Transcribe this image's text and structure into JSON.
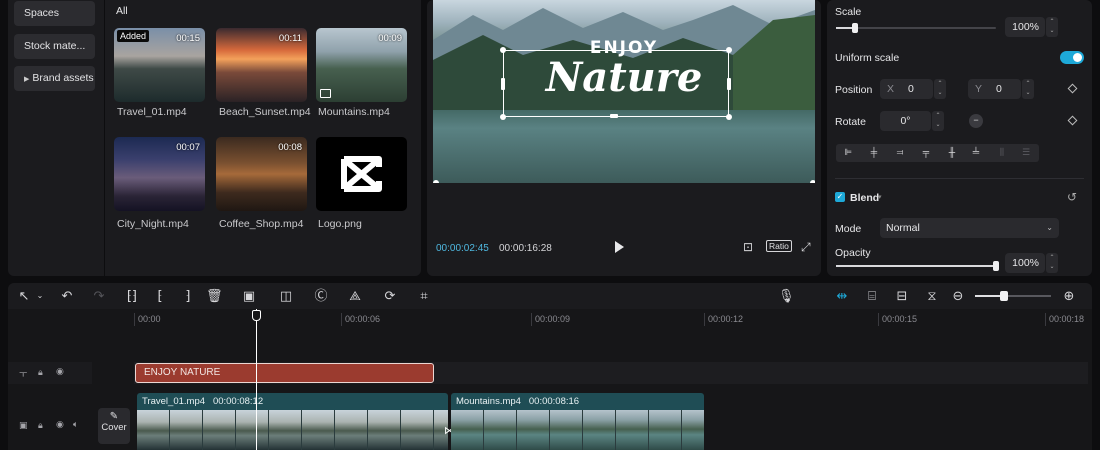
{
  "left_nav": {
    "items": [
      {
        "label": "Spaces",
        "has_arrow": false
      },
      {
        "label": "Stock mate...",
        "has_arrow": false
      },
      {
        "label": "Brand assets",
        "has_arrow": true
      }
    ]
  },
  "media": {
    "tab": "All",
    "items": [
      {
        "name": "Travel_01.mp4",
        "duration": "00:15",
        "badge": "Added"
      },
      {
        "name": "Beach_Sunset.mp4",
        "duration": "00:11",
        "badge": ""
      },
      {
        "name": "Mountains.mp4",
        "duration": "00:09",
        "badge": ""
      },
      {
        "name": "City_Night.mp4",
        "duration": "00:07",
        "badge": ""
      },
      {
        "name": "Coffee_Shop.mp4",
        "duration": "00:08",
        "badge": ""
      },
      {
        "name": "Logo.png",
        "duration": "",
        "badge": ""
      }
    ]
  },
  "player": {
    "overlay_line1": "ENJOY",
    "overlay_line2": "Nature",
    "current_time": "00:00:02:45",
    "total_time": "00:00:16:28",
    "ratio_label": "Ratio"
  },
  "inspector": {
    "scale_label": "Scale",
    "scale_value": "100%",
    "scale_fraction": 0.12,
    "uniform_scale_label": "Uniform scale",
    "uniform_scale_on": true,
    "position_label": "Position",
    "pos_x_label": "X",
    "pos_x_value": "0",
    "pos_y_label": "Y",
    "pos_y_value": "0",
    "rotate_label": "Rotate",
    "rotate_value": "0°",
    "blend_label": "Blend",
    "blend_checked": true,
    "mode_label": "Mode",
    "mode_value": "Normal",
    "opacity_label": "Opacity",
    "opacity_value": "100%",
    "opacity_fraction": 1.0
  },
  "timeline": {
    "ruler": [
      "00:00",
      "00:00:06",
      "00:00:09",
      "00:00:12",
      "00:00:15",
      "00:00:18"
    ],
    "text_clip_label": "ENJOY NATURE",
    "cover_label": "Cover",
    "clips": [
      {
        "name": "Travel_01.mp4",
        "duration": "00:00:08:12"
      },
      {
        "name": "Mountains.mp4",
        "duration": "00:00:08:16"
      }
    ],
    "zoom_fraction": 0.37
  },
  "colors": {
    "accent": "#1ea9d8",
    "text_clip": "#9b3b2f",
    "video_clip": "#1f4d55",
    "panel_bg": "#1b1b1e"
  }
}
